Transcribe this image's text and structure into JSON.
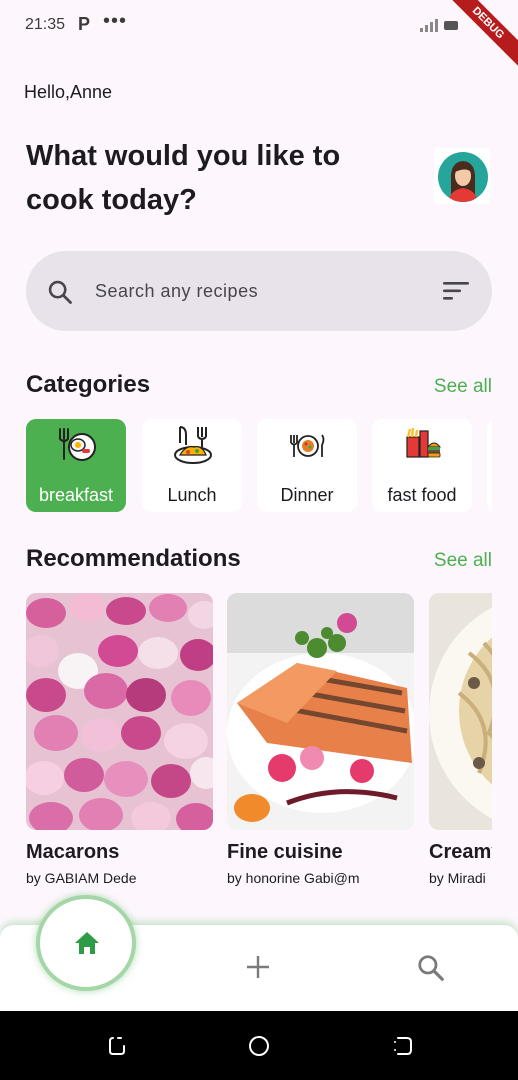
{
  "status_bar": {
    "time": "21:35",
    "p_glyph": "P",
    "dots": "•••",
    "debug_banner": "DEBUG"
  },
  "header": {
    "greeting": "Hello,Anne",
    "headline": "What would you like to cook today?"
  },
  "search": {
    "placeholder": "Search any recipes",
    "icon": "search-icon",
    "filter_icon": "filter-icon"
  },
  "categories": {
    "title": "Categories",
    "see_all": "See all",
    "items": [
      {
        "label": "breakfast",
        "icon": "breakfast-icon",
        "selected": true
      },
      {
        "label": "Lunch",
        "icon": "lunch-icon",
        "selected": false
      },
      {
        "label": "Dinner",
        "icon": "dinner-icon",
        "selected": false
      },
      {
        "label": "fast food",
        "icon": "fast-food-icon",
        "selected": false
      }
    ]
  },
  "recommendations": {
    "title": "Recommendations",
    "see_all": "See all",
    "items": [
      {
        "title": "Macarons",
        "author": "by GABIAM Dede"
      },
      {
        "title": "Fine cuisine",
        "author": "by honorine Gabi@m"
      },
      {
        "title": "Creamy",
        "author": "by Miradi"
      }
    ]
  },
  "bottom_nav": {
    "items": [
      "home-icon",
      "add-icon",
      "search-icon"
    ],
    "active": "home"
  },
  "colors": {
    "accent": "#4caf50",
    "background": "#fdf7fd",
    "search_bg": "#e8e2ea",
    "debug": "#b71c1c"
  }
}
